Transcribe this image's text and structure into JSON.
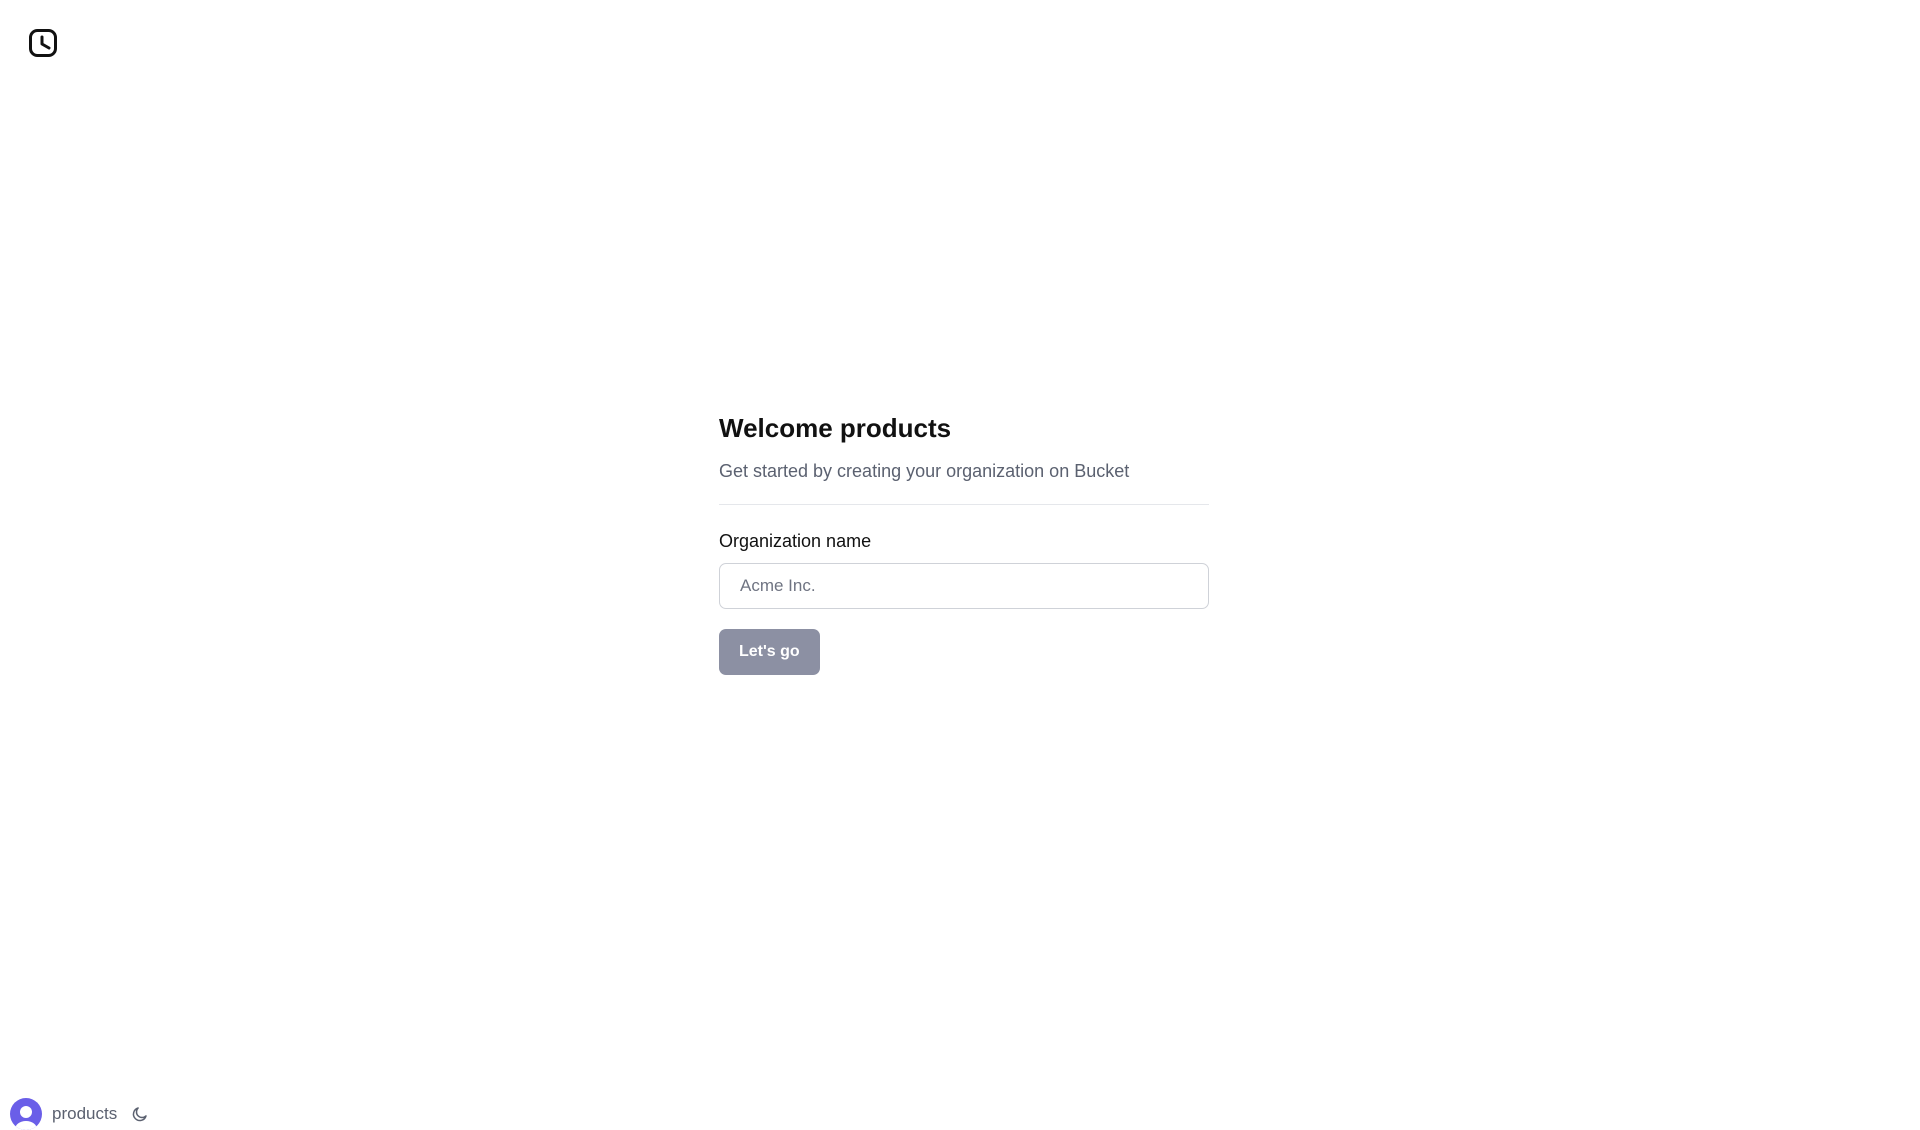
{
  "header": {
    "logo_icon": "bucket-logo-icon"
  },
  "welcome": {
    "title": "Welcome products",
    "subtitle": "Get started by creating your organization on Bucket"
  },
  "form": {
    "org_name_label": "Organization name",
    "org_name_value": "",
    "org_name_placeholder": "Acme Inc.",
    "submit_label": "Let's go"
  },
  "footer": {
    "avatar_icon": "user-avatar-icon",
    "username": "products",
    "theme_icon": "moon-icon"
  },
  "colors": {
    "button_disabled_bg": "#8c90a3",
    "avatar_bg": "#6a5ee8",
    "muted_text": "#5b6170"
  }
}
